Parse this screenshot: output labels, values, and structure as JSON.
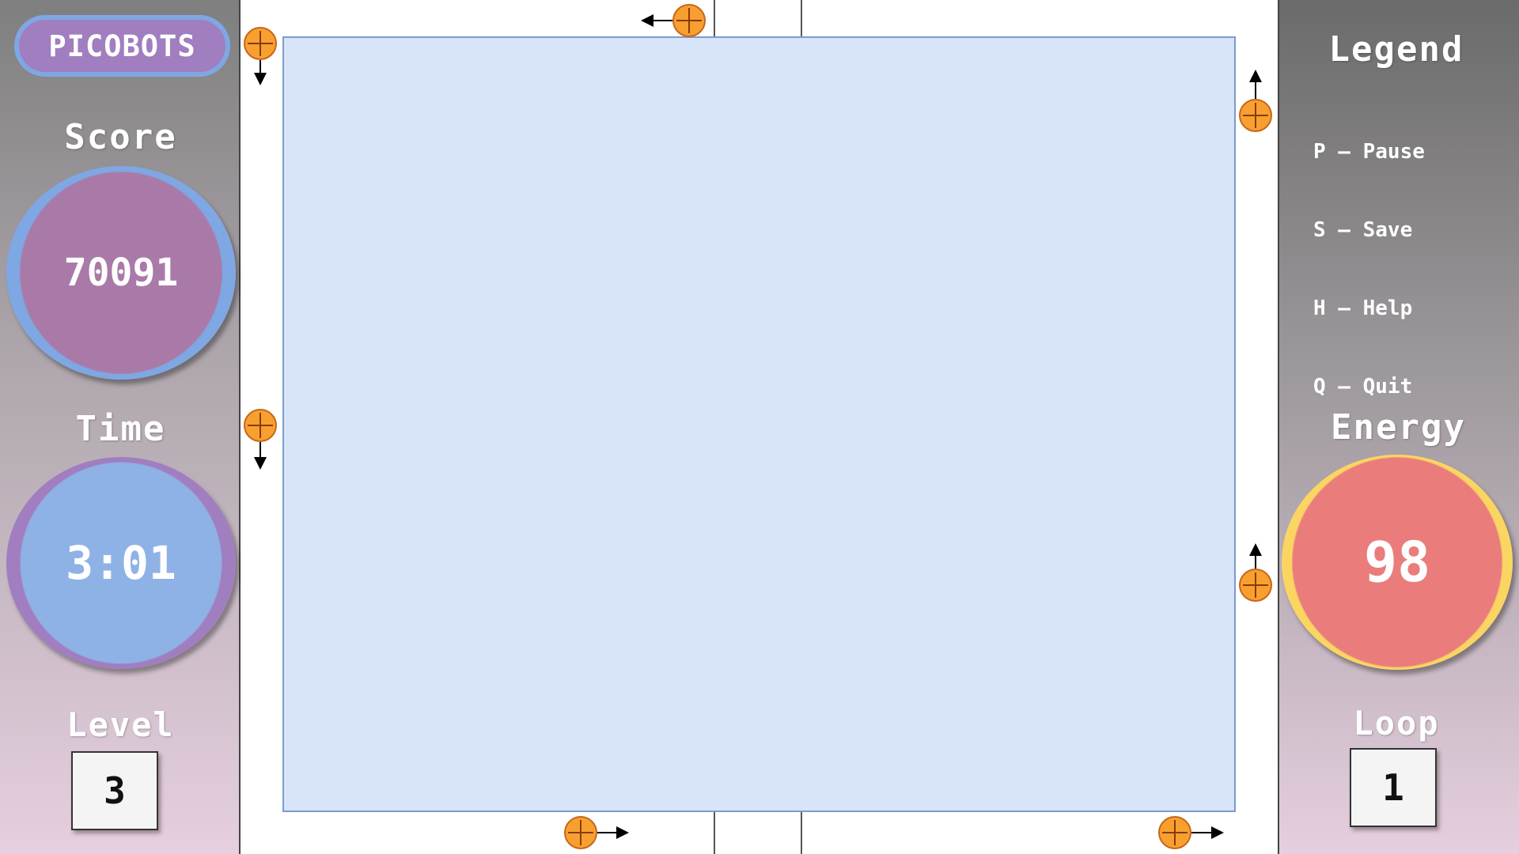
{
  "game": {
    "title": "PICOBOTS",
    "score": {
      "label": "Score",
      "value": "70091"
    },
    "time": {
      "label": "Time",
      "value": "3:01"
    },
    "level": {
      "label": "Level",
      "value": "3"
    },
    "legend": {
      "title": "Legend",
      "items": [
        "P – Pause",
        "S – Save",
        "H – Help",
        "Q – Quit"
      ]
    },
    "energy": {
      "label": "Energy",
      "value": "98"
    },
    "loop": {
      "label": "Loop",
      "value": "1"
    }
  },
  "colors": {
    "score_ring": "#7fa7e3",
    "score_fill": "#a97aa8",
    "time_ring": "#a07ec0",
    "time_fill": "#8fb2e6",
    "energy_ring": "#fbd562",
    "energy_fill": "#ea7c7c",
    "bot": "#f7a030",
    "playfield": "#d8e5f8"
  },
  "bots": [
    {
      "name": "bot-top-left",
      "direction": "down"
    },
    {
      "name": "bot-top-center",
      "direction": "left"
    },
    {
      "name": "bot-left-middle",
      "direction": "down"
    },
    {
      "name": "bot-right-top",
      "direction": "up"
    },
    {
      "name": "bot-right-middle",
      "direction": "up"
    },
    {
      "name": "bot-bottom-left",
      "direction": "right"
    },
    {
      "name": "bot-bottom-right",
      "direction": "right"
    }
  ]
}
